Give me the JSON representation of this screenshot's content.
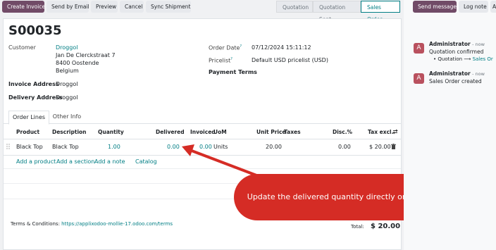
{
  "toolbar": {
    "create_invoice": "Create Invoice",
    "send_by_email": "Send by Email",
    "preview": "Preview",
    "cancel": "Cancel",
    "sync_shipment": "Sync Shipment"
  },
  "statusbar": [
    "Quotation",
    "Quotation Sent",
    "Sales Order"
  ],
  "record": {
    "name": "S00035",
    "customer_label": "Customer",
    "customer": "Droggol",
    "address_line1": "Jan De Clerckstraat 7",
    "address_line2": "8400 Oostende",
    "address_line3": "Belgium",
    "invoice_address_label": "Invoice Address",
    "invoice_address": "Droggol",
    "delivery_address_label": "Delivery Address",
    "delivery_address": "Droggol",
    "order_date_label": "Order Date",
    "order_date": "07/12/2024 15:11:12",
    "pricelist_label": "Pricelist",
    "pricelist": "Default USD pricelist (USD)",
    "payment_terms_label": "Payment Terms",
    "help_mark": "?"
  },
  "tabs": [
    "Order Lines",
    "Other Info"
  ],
  "table": {
    "headers": {
      "product": "Product",
      "description": "Description",
      "quantity": "Quantity",
      "delivered": "Delivered",
      "invoiced": "Invoiced",
      "uom": "UoM",
      "unit_price": "Unit Price",
      "taxes": "Taxes",
      "disc": "Disc.%",
      "tax_excl": "Tax excl."
    },
    "row": {
      "product": "Black Top",
      "description": "Black Top",
      "quantity": "1.00",
      "delivered": "0.00",
      "invoiced": "0.00",
      "uom": "Units",
      "unit_price": "20.00",
      "disc": "0.00",
      "tax_excl": "$ 20.00"
    },
    "actions": [
      "Add a product",
      "Add a section",
      "Add a note",
      "Catalog"
    ]
  },
  "footer": {
    "terms_label": "Terms & Conditions:",
    "terms_link": "https://applixodoo-mollie-17.odoo.com/terms",
    "total_label": "Total:",
    "total_value": "$ 20.00"
  },
  "annotation": {
    "text": "Update the delivered quantity directly on the Sale Order",
    "color": "#d52c25"
  },
  "chatter": {
    "send_message": "Send message",
    "log_note": "Log note",
    "more": "A",
    "messages": [
      {
        "author": "Administrator",
        "time": "- now",
        "line1": "Quotation confirmed",
        "bullet": "Quotation",
        "arrow": "⟶",
        "link": "Sales Or"
      },
      {
        "author": "Administrator",
        "time": "- now",
        "line1": "Sales Order created"
      }
    ],
    "avatar_letter": "A"
  }
}
